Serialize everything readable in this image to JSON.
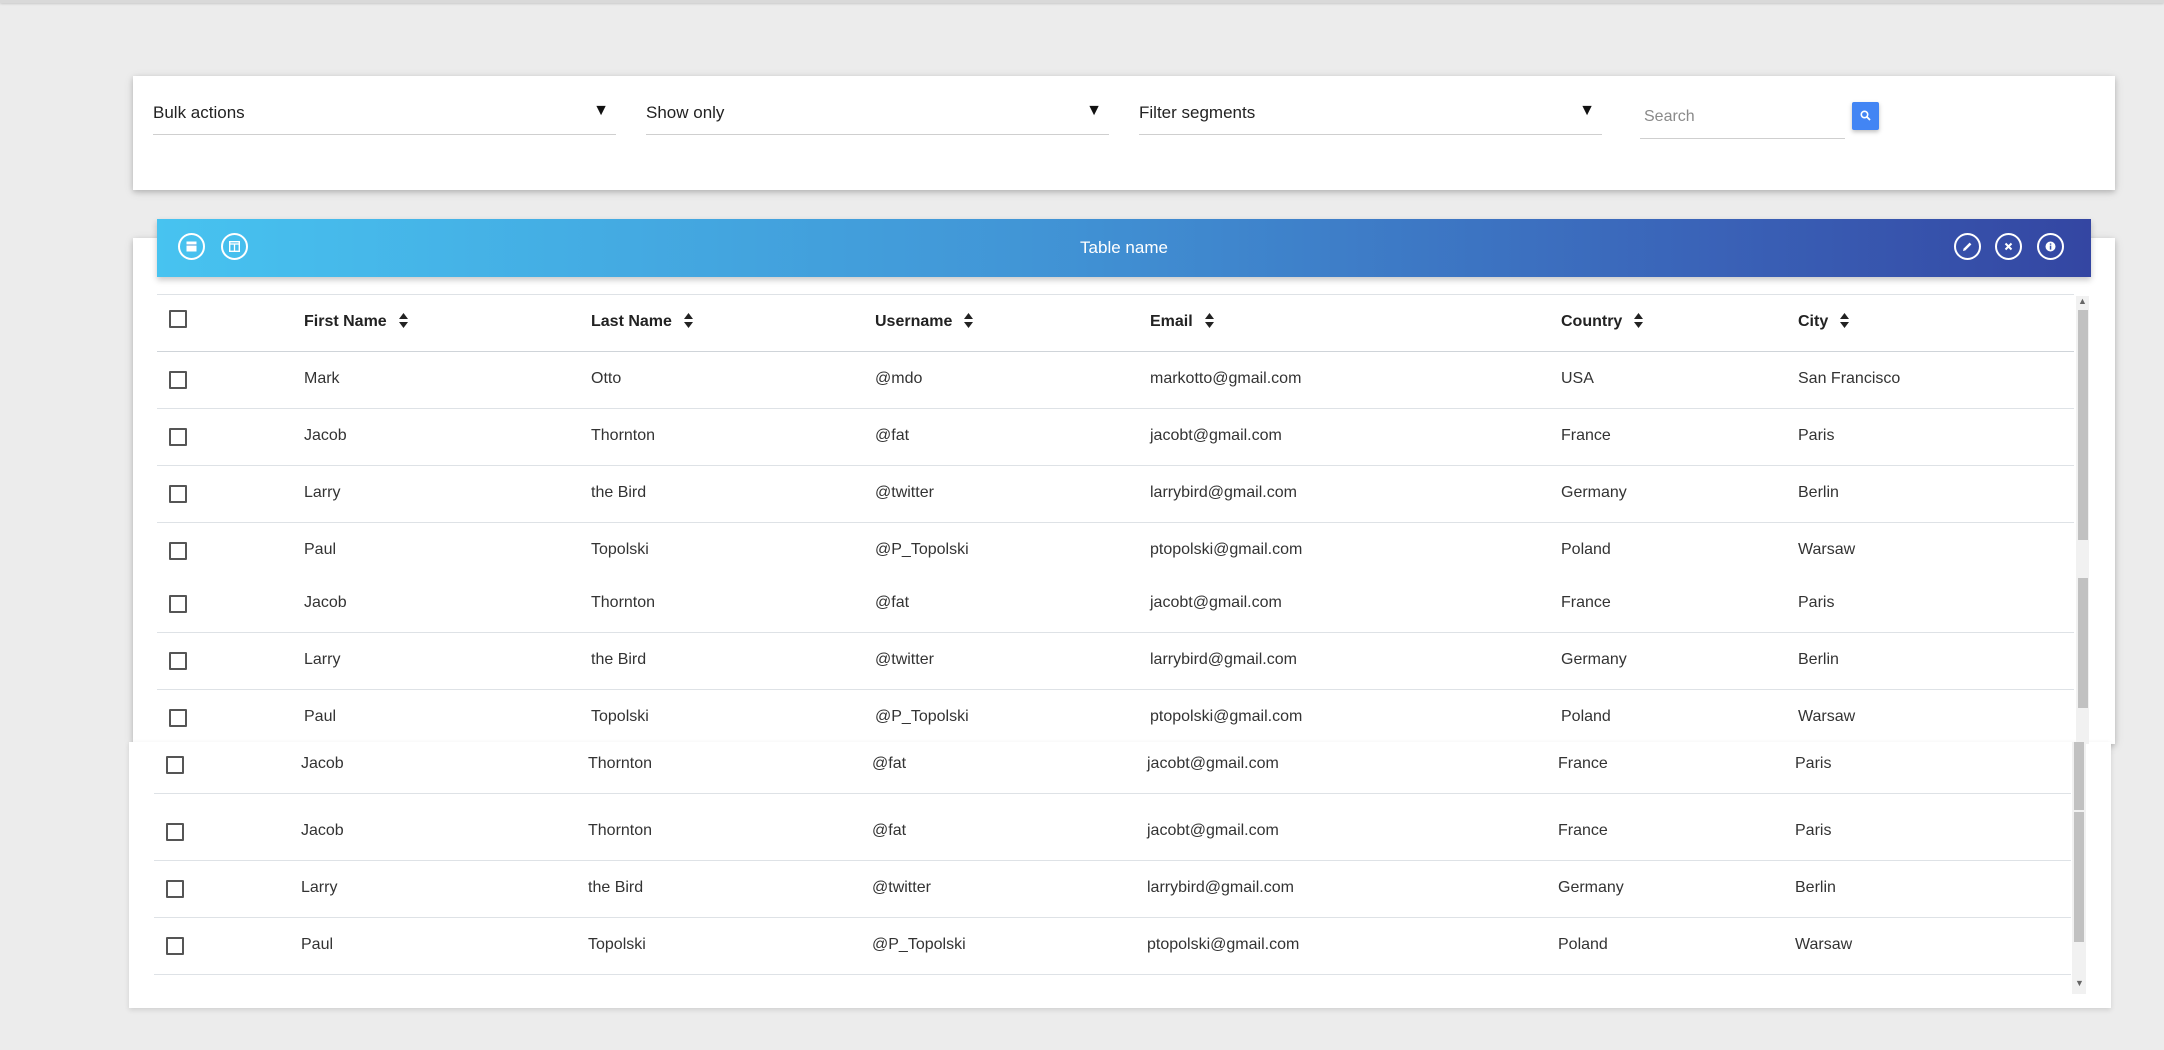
{
  "filters": {
    "bulk_actions": "Bulk actions",
    "show_only": "Show only",
    "filter_segments": "Filter segments",
    "search_placeholder": "Search"
  },
  "table": {
    "title": "Table name",
    "columns": [
      "First Name",
      "Last Name",
      "Username",
      "Email",
      "Country",
      "City"
    ],
    "rows": [
      [
        "Mark",
        "Otto",
        "@mdo",
        "markotto@gmail.com",
        "USA",
        "San Francisco"
      ],
      [
        "Jacob",
        "Thornton",
        "@fat",
        "jacobt@gmail.com",
        "France",
        "Paris"
      ],
      [
        "Larry",
        "the Bird",
        "@twitter",
        "larrybird@gmail.com",
        "Germany",
        "Berlin"
      ],
      [
        "Paul",
        "Topolski",
        "@P_Topolski",
        "ptopolski@gmail.com",
        "Poland",
        "Warsaw"
      ],
      [
        "Jacob",
        "Thornton",
        "@fat",
        "jacobt@gmail.com",
        "France",
        "Paris"
      ],
      [
        "Larry",
        "the Bird",
        "@twitter",
        "larrybird@gmail.com",
        "Germany",
        "Berlin"
      ],
      [
        "Paul",
        "Topolski",
        "@P_Topolski",
        "ptopolski@gmail.com",
        "Poland",
        "Warsaw"
      ]
    ],
    "rows2": [
      [
        "Jacob",
        "Thornton",
        "@fat",
        "jacobt@gmail.com",
        "France",
        "Paris"
      ],
      [
        "Jacob",
        "Thornton",
        "@fat",
        "jacobt@gmail.com",
        "France",
        "Paris"
      ],
      [
        "Larry",
        "the Bird",
        "@twitter",
        "larrybird@gmail.com",
        "Germany",
        "Berlin"
      ],
      [
        "Paul",
        "Topolski",
        "@P_Topolski",
        "ptopolski@gmail.com",
        "Poland",
        "Warsaw"
      ]
    ]
  },
  "icons": {
    "left": [
      "table-icon",
      "columns-icon"
    ],
    "right": [
      "pencil-icon",
      "close-icon",
      "info-icon"
    ],
    "search": "search-icon",
    "sort": "sort-icon"
  },
  "colors": {
    "header_gradient_start": "#47c3f0",
    "header_gradient_end": "#3446a2",
    "search_button": "#4285f4"
  }
}
